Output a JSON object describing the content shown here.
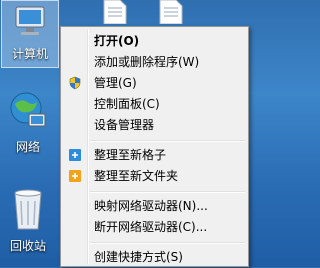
{
  "desktop": {
    "icons": [
      {
        "label": "计算机"
      },
      {
        "label": "网络"
      },
      {
        "label": "回收站"
      }
    ]
  },
  "context_menu": {
    "items": [
      {
        "label": "打开(O)",
        "bold": true,
        "icon": ""
      },
      {
        "label": "添加或删除程序(W)",
        "icon": ""
      },
      {
        "label": "管理(G)",
        "icon": "shield-icon"
      },
      {
        "label": "控制面板(C)",
        "icon": ""
      },
      {
        "label": "设备管理器",
        "icon": ""
      },
      {
        "label": "整理至新格子",
        "icon": "plus-blue-icon"
      },
      {
        "label": "整理至新文件夹",
        "icon": "plus-orange-icon"
      },
      {
        "label": "映射网络驱动器(N)...",
        "icon": ""
      },
      {
        "label": "断开网络驱动器(C)...",
        "icon": ""
      },
      {
        "label": "创建快捷方式(S)",
        "icon": ""
      }
    ]
  },
  "colors": {
    "desktop": "#2f6fb0",
    "menu_bg": "#f0f0f0",
    "plus_blue": "#2d8ddb",
    "plus_orange": "#f2a31b"
  }
}
